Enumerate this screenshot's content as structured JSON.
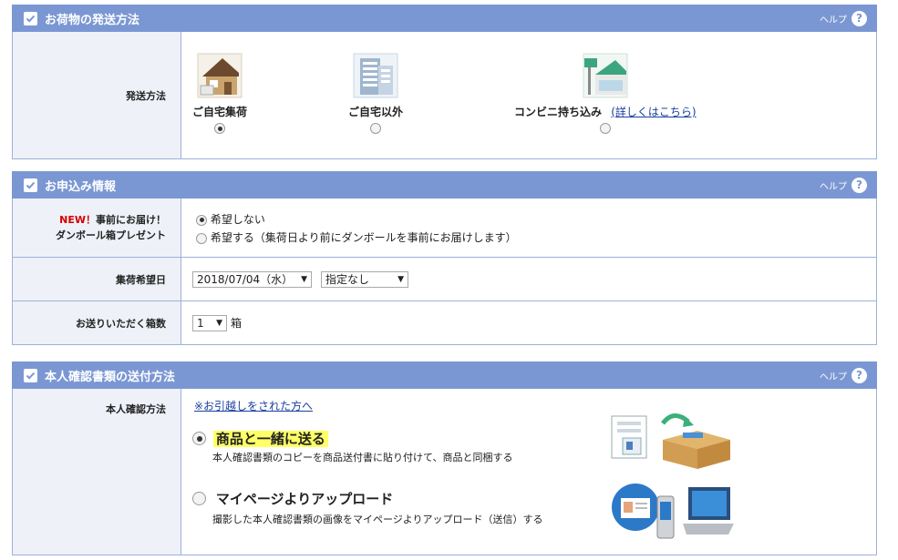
{
  "help_label": "ヘルプ",
  "help_icon_glyph": "?",
  "colors": {
    "header_bg": "#7b97d3",
    "label_bg": "#eef1f8",
    "border": "#9eb1d8",
    "highlight": "#ffff66",
    "new_red": "#d40000",
    "link": "#1a3fa0"
  },
  "shipping": {
    "title": "お荷物の発送方法",
    "row_label": "発送方法",
    "methods": [
      {
        "label": "ご自宅集荷",
        "icon": "house-icon",
        "selected": true
      },
      {
        "label": "ご自宅以外",
        "icon": "building-icon",
        "selected": false
      },
      {
        "label": "コンビニ持ち込み",
        "icon": "convenience-store-icon",
        "selected": false
      }
    ],
    "details_link": "(詳しくはこちら)"
  },
  "application": {
    "title": "お申込み情報",
    "box_present": {
      "new_badge": "NEW！",
      "label_line1": "事前にお届け！",
      "label_line2": "ダンボール箱プレゼント",
      "options": [
        {
          "label": "希望しない",
          "selected": true
        },
        {
          "label": "希望する（集荷日より前にダンボールを事前にお届けします）",
          "selected": false
        }
      ]
    },
    "pickup_date": {
      "label": "集荷希望日",
      "date_value": "2018/07/04（水）",
      "time_value": "指定なし"
    },
    "box_count": {
      "label": "お送りいただく箱数",
      "count_value": "1",
      "unit": "箱"
    }
  },
  "id_docs": {
    "title": "本人確認書類の送付方法",
    "row_label": "本人確認方法",
    "moved_link": "※お引越しをされた方へ",
    "options": [
      {
        "title": "商品と一緒に送る",
        "desc": "本人確認書類のコピーを商品送付書に貼り付けて、商品と同梱する",
        "selected": true,
        "highlight": true,
        "icon": "documents-into-box-icon"
      },
      {
        "title": "マイページよりアップロード",
        "desc": "撮影した本人確認書類の画像をマイページよりアップロード（送信）する",
        "selected": false,
        "highlight": false,
        "icon": "phone-and-computer-icon"
      }
    ]
  }
}
